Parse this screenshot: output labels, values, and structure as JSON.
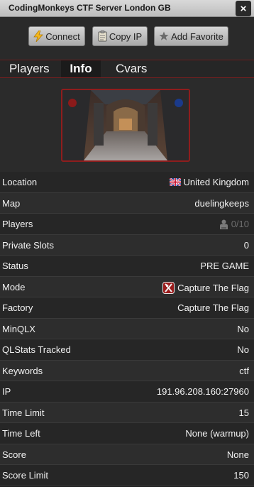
{
  "window": {
    "title": "CodingMonkeys CTF Server London GB",
    "close_label": "×"
  },
  "toolbar": {
    "connect_label": "Connect",
    "copy_ip_label": "Copy IP",
    "add_favorite_label": "Add Favorite"
  },
  "tabs": [
    {
      "label": "Players",
      "active": false
    },
    {
      "label": "Info",
      "active": true
    },
    {
      "label": "Cvars",
      "active": false
    }
  ],
  "map_preview": {
    "map": "duelingkeeps"
  },
  "info": [
    {
      "key": "Location",
      "value": "United Kingdom",
      "icon": "uk-flag-icon"
    },
    {
      "key": "Map",
      "value": "duelingkeeps"
    },
    {
      "key": "Players",
      "value": "0/10",
      "icon": "player-icon",
      "muted": true
    },
    {
      "key": "Private Slots",
      "value": "0"
    },
    {
      "key": "Status",
      "value": "PRE GAME"
    },
    {
      "key": "Mode",
      "value": "Capture The Flag",
      "icon": "ctf-icon"
    },
    {
      "key": "Factory",
      "value": "Capture The Flag"
    },
    {
      "key": "MinQLX",
      "value": "No"
    },
    {
      "key": "QLStats Tracked",
      "value": "No"
    },
    {
      "key": "Keywords",
      "value": "ctf"
    },
    {
      "key": "IP",
      "value": "191.96.208.160:27960"
    },
    {
      "key": "Time Limit",
      "value": "15"
    },
    {
      "key": "Time Left",
      "value": "None (warmup)"
    },
    {
      "key": "Score",
      "value": "None"
    },
    {
      "key": "Score Limit",
      "value": "150"
    }
  ],
  "colors": {
    "accent": "#8f1d1d",
    "background": "#1e1e1e",
    "muted_text": "#6e6e6e"
  }
}
